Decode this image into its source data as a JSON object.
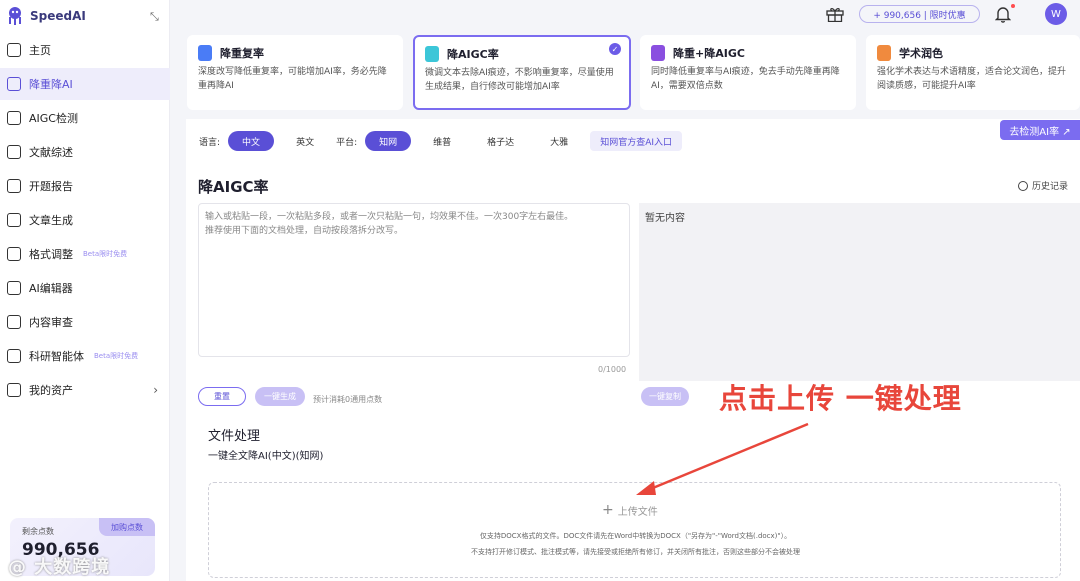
{
  "app": {
    "name": "SpeedAI"
  },
  "sidebar": {
    "items": [
      {
        "label": "主页",
        "icon": "grid-icon"
      },
      {
        "label": "降重降AI",
        "icon": "wand-icon",
        "active": true
      },
      {
        "label": "AIGC检测",
        "icon": "scan-icon"
      },
      {
        "label": "文献综述",
        "icon": "doc-icon"
      },
      {
        "label": "开题报告",
        "icon": "report-icon"
      },
      {
        "label": "文章生成",
        "icon": "pen-icon"
      },
      {
        "label": "格式调整",
        "icon": "format-icon",
        "tag": "Beta限时免费"
      },
      {
        "label": "AI编辑器",
        "icon": "editor-icon"
      },
      {
        "label": "内容审查",
        "icon": "review-icon"
      },
      {
        "label": "科研智能体",
        "icon": "robot-icon",
        "tag": "Beta限时免费"
      },
      {
        "label": "我的资产",
        "icon": "wallet-icon",
        "chevron": "›"
      }
    ],
    "points": {
      "label": "剩余点数",
      "value": "990,656",
      "buy": "加购点数"
    },
    "watermark": "@ 大数跨境"
  },
  "header": {
    "points_pill": "+ 990,656  |  限时优惠",
    "avatar": "W"
  },
  "modes": [
    {
      "title": "降重复率",
      "desc": "深度改写降低重复率，可能增加AI率，务必先降重再降AI",
      "color": "#4a7cf6"
    },
    {
      "title": "降AIGC率",
      "desc": "微调文本去除AI痕迹，不影响重复率，尽量使用生成结果，自行修改可能增加AI率",
      "color": "#3cc6d8",
      "selected": true
    },
    {
      "title": "降重+降AIGC",
      "desc": "同时降低重复率与AI痕迹，免去手动先降重再降AI，需要双倍点数",
      "color": "#8a4fe0"
    },
    {
      "title": "学术润色",
      "desc": "强化学术表达与术语精度，适合论文润色，提升阅读质感，可能提升AI率",
      "color": "#f08a3e"
    }
  ],
  "filters": {
    "lang_label": "语言:",
    "langs": [
      "中文",
      "英文"
    ],
    "platform_label": "平台:",
    "platforms": [
      "知网",
      "维普",
      "格子达",
      "大雅"
    ],
    "link": "知网官方查AI入口",
    "detect_button": "去检测AI率 ↗"
  },
  "editor": {
    "title": "降AIGC率",
    "history": "历史记录",
    "placeholder_line1": "输入或粘贴一段，一次粘贴多段，或者一次只粘贴一句，均效果不佳。一次300字左右最佳。",
    "placeholder_line2": "推荐使用下面的文档处理，自动按段落拆分改写。",
    "counter": "0/1000",
    "output_empty": "暂无内容",
    "reset": "重置",
    "generate": "一键生成",
    "cost": "预计消耗0通用点数",
    "copy": "一键复制"
  },
  "annotation": "点击上传 一键处理",
  "file": {
    "title": "文件处理",
    "subtitle": "一键全文降AI(中文)(知网)",
    "upload": "上传文件",
    "note1": "仅支持DOCX格式的文件。DOC文件请先在Word中转换为DOCX（\"另存为\"-\"Word文档(.docx)\"）。",
    "note2": "不支持打开修订模式、批注模式等，请先接受或拒绝所有修订，并关闭所有批注，否则这些部分不会被处理"
  },
  "colors": {
    "accent": "#5a4fd6",
    "annotation": "#e8463b"
  }
}
